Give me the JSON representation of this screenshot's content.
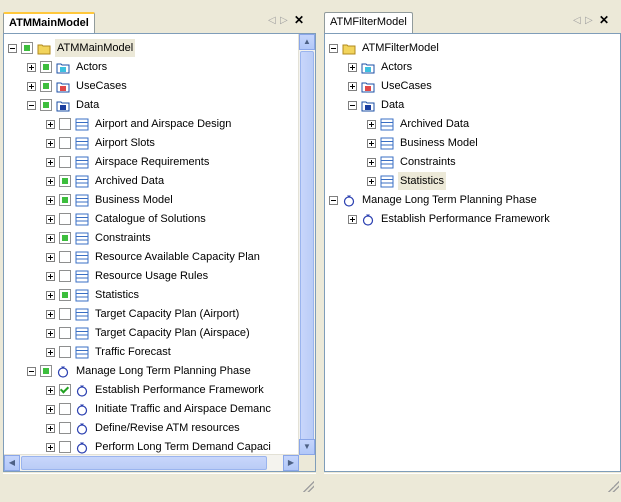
{
  "left_panel": {
    "tab": "ATMMainModel",
    "tree": [
      {
        "level": 0,
        "expander": "minus",
        "check": "partial",
        "icon": "folder-icon",
        "label": "ATMMainModel",
        "selected": true
      },
      {
        "level": 1,
        "expander": "plus",
        "check": "partial",
        "icon": "actors-package-icon",
        "label": "Actors"
      },
      {
        "level": 1,
        "expander": "plus",
        "check": "partial",
        "icon": "usecases-package-icon",
        "label": "UseCases"
      },
      {
        "level": 1,
        "expander": "minus",
        "check": "partial",
        "icon": "data-package-icon",
        "label": "Data"
      },
      {
        "level": 2,
        "expander": "plus",
        "check": "empty",
        "icon": "class-icon",
        "label": "Airport and Airspace Design"
      },
      {
        "level": 2,
        "expander": "plus",
        "check": "empty",
        "icon": "class-icon",
        "label": "Airport Slots"
      },
      {
        "level": 2,
        "expander": "plus",
        "check": "empty",
        "icon": "class-icon",
        "label": "Airspace Requirements"
      },
      {
        "level": 2,
        "expander": "plus",
        "check": "partial",
        "icon": "class-icon",
        "label": "Archived Data"
      },
      {
        "level": 2,
        "expander": "plus",
        "check": "partial",
        "icon": "class-icon",
        "label": "Business Model"
      },
      {
        "level": 2,
        "expander": "plus",
        "check": "empty",
        "icon": "class-icon",
        "label": "Catalogue of Solutions"
      },
      {
        "level": 2,
        "expander": "plus",
        "check": "partial",
        "icon": "class-icon",
        "label": "Constraints"
      },
      {
        "level": 2,
        "expander": "plus",
        "check": "empty",
        "icon": "class-icon",
        "label": "Resource Available Capacity Plan"
      },
      {
        "level": 2,
        "expander": "plus",
        "check": "empty",
        "icon": "class-icon",
        "label": "Resource Usage Rules"
      },
      {
        "level": 2,
        "expander": "plus",
        "check": "partial",
        "icon": "class-icon",
        "label": "Statistics"
      },
      {
        "level": 2,
        "expander": "plus",
        "check": "empty",
        "icon": "class-icon",
        "label": "Target Capacity Plan (Airport)"
      },
      {
        "level": 2,
        "expander": "plus",
        "check": "empty",
        "icon": "class-icon",
        "label": "Target Capacity Plan (Airspace)"
      },
      {
        "level": 2,
        "expander": "plus",
        "check": "empty",
        "icon": "class-icon",
        "label": "Traffic Forecast"
      },
      {
        "level": 1,
        "expander": "minus",
        "check": "partial",
        "icon": "process-icon",
        "label": "Manage Long Term Planning Phase"
      },
      {
        "level": 2,
        "expander": "plus",
        "check": "checked",
        "icon": "process-icon",
        "label": "Establish Performance Framework"
      },
      {
        "level": 2,
        "expander": "plus",
        "check": "empty",
        "icon": "process-icon",
        "label": "Initiate Traffic and Airspace Demanc"
      },
      {
        "level": 2,
        "expander": "plus",
        "check": "empty",
        "icon": "process-icon",
        "label": "Define/Revise ATM resources"
      },
      {
        "level": 2,
        "expander": "plus",
        "check": "empty",
        "icon": "process-icon",
        "label": "Perform Long Term Demand Capaci"
      }
    ]
  },
  "right_panel": {
    "tab": "ATMFilterModel",
    "tree": [
      {
        "level": 0,
        "expander": "minus",
        "check": "none",
        "icon": "folder-icon",
        "label": "ATMFilterModel"
      },
      {
        "level": 1,
        "expander": "plus",
        "check": "none",
        "icon": "actors-package-icon",
        "label": "Actors"
      },
      {
        "level": 1,
        "expander": "plus",
        "check": "none",
        "icon": "usecases-package-icon",
        "label": "UseCases"
      },
      {
        "level": 1,
        "expander": "minus",
        "check": "none",
        "icon": "data-package-icon",
        "label": "Data"
      },
      {
        "level": 2,
        "expander": "plus",
        "check": "none",
        "icon": "class-icon",
        "label": "Archived Data"
      },
      {
        "level": 2,
        "expander": "plus",
        "check": "none",
        "icon": "class-icon",
        "label": "Business Model"
      },
      {
        "level": 2,
        "expander": "plus",
        "check": "none",
        "icon": "class-icon",
        "label": "Constraints"
      },
      {
        "level": 2,
        "expander": "plus",
        "check": "none",
        "icon": "class-icon",
        "label": "Statistics",
        "selected": true
      },
      {
        "level": 0,
        "expander": "minus",
        "check": "none",
        "icon": "process-icon",
        "label": "Manage Long Term Planning Phase"
      },
      {
        "level": 1,
        "expander": "plus",
        "check": "none",
        "icon": "process-icon",
        "label": "Establish Performance Framework"
      }
    ]
  },
  "tab_controls": {
    "prev": "◁",
    "next": "▷",
    "close": "✕"
  },
  "colors": {
    "window_bg": "#ECE9D8",
    "tree_bg": "#FFFFFF",
    "tab_highlight": "#FFC83C",
    "check_green": "#3DBE3D",
    "class_icon_blue": "#3A6FC4",
    "process_icon_blue": "#2A3FB0",
    "folder_yellow": "#F2D45C"
  }
}
